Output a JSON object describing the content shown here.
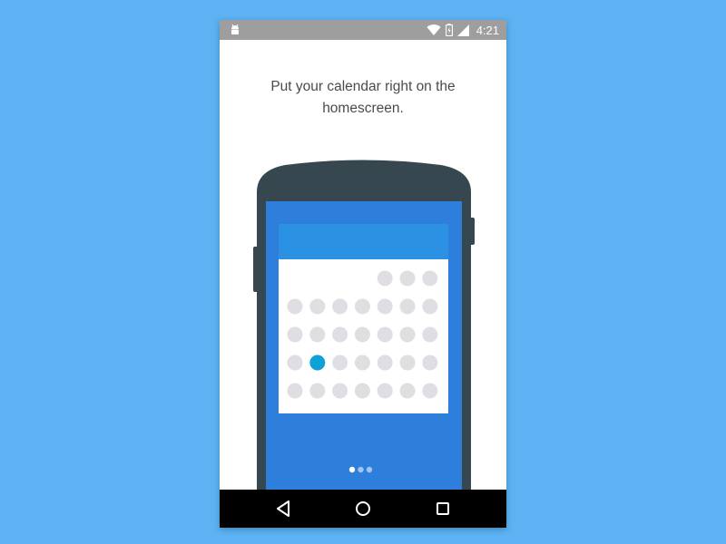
{
  "status_bar": {
    "time": "4:21",
    "icons": [
      "android-debug-icon",
      "wifi-icon",
      "battery-charging-icon",
      "cell-signal-icon"
    ]
  },
  "onboarding": {
    "message": "Put your calendar right on the homescreen.",
    "page_indicator": {
      "total": 3,
      "active_index": 0
    }
  },
  "illustration": {
    "phone_body_color": "#37474f",
    "screen_color": "#2d7fdb",
    "widget_header_color": "#2b91e3",
    "widget_body_color": "#ffffff",
    "day_dot_color": "#e0dde3",
    "selected_day_color": "#0ea1d8",
    "selected_day": {
      "row": 3,
      "col": 1
    }
  },
  "nav_bar": {
    "buttons": [
      "back",
      "home",
      "recents"
    ]
  },
  "colors": {
    "background": "#5cb2f2",
    "status_bar": "#9e9e9e",
    "nav_bar": "#000000"
  }
}
